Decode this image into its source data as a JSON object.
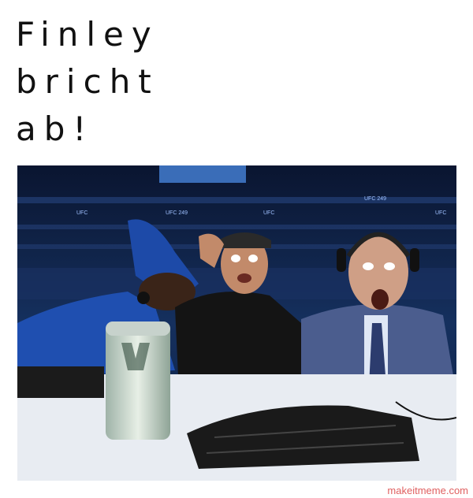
{
  "caption": {
    "lines": [
      "Finley",
      "bricht",
      "ab!"
    ]
  },
  "photo": {
    "description_icon": "photo-commentators",
    "arena_signs": [
      "UFC 249",
      "UFC",
      "UFC 249",
      "UFC",
      "UFC 249",
      "UFC"
    ]
  },
  "watermark": "makeitmeme.com"
}
